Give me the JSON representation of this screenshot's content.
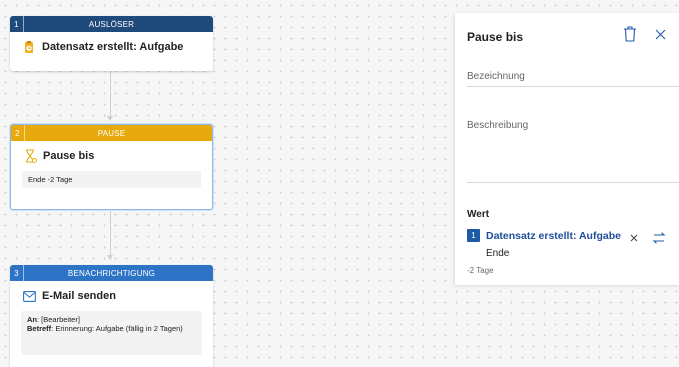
{
  "colors": {
    "trigger": "#1f4a7c",
    "pause": "#e8a90f",
    "notification": "#2e74c6",
    "accent": "#1f5aa6"
  },
  "steps": [
    {
      "number": "1",
      "header": "AUSLÖSER",
      "icon": "document-clock-icon",
      "title": "Datensatz erstellt: Aufgabe"
    },
    {
      "number": "2",
      "header": "PAUSE",
      "icon": "hourglass-icon",
      "title": "Pause bis",
      "detail": "Ende -2 Tage"
    },
    {
      "number": "3",
      "header": "BENACHRICHTIGUNG",
      "icon": "mail-icon",
      "title": "E-Mail senden",
      "detail": {
        "to_label": "An",
        "to_value": ": [Bearbeiter]",
        "subject_label": "Betreff",
        "subject_value": ": Erinnerung: Aufgabe (fällig in 2 Tagen)"
      }
    }
  ],
  "panel": {
    "title": "Pause bis",
    "delete_icon": "trash-icon",
    "close_icon": "close-icon",
    "name_placeholder": "Bezeichnung",
    "description_placeholder": "Beschreibung",
    "value_label": "Wert",
    "value_ref": {
      "number": "1",
      "text": "Datensatz erstellt: Aufgabe",
      "field": "Ende",
      "offset": "-2 Tage"
    },
    "clear_icon": "clear-icon",
    "swap_icon": "swap-icon"
  }
}
